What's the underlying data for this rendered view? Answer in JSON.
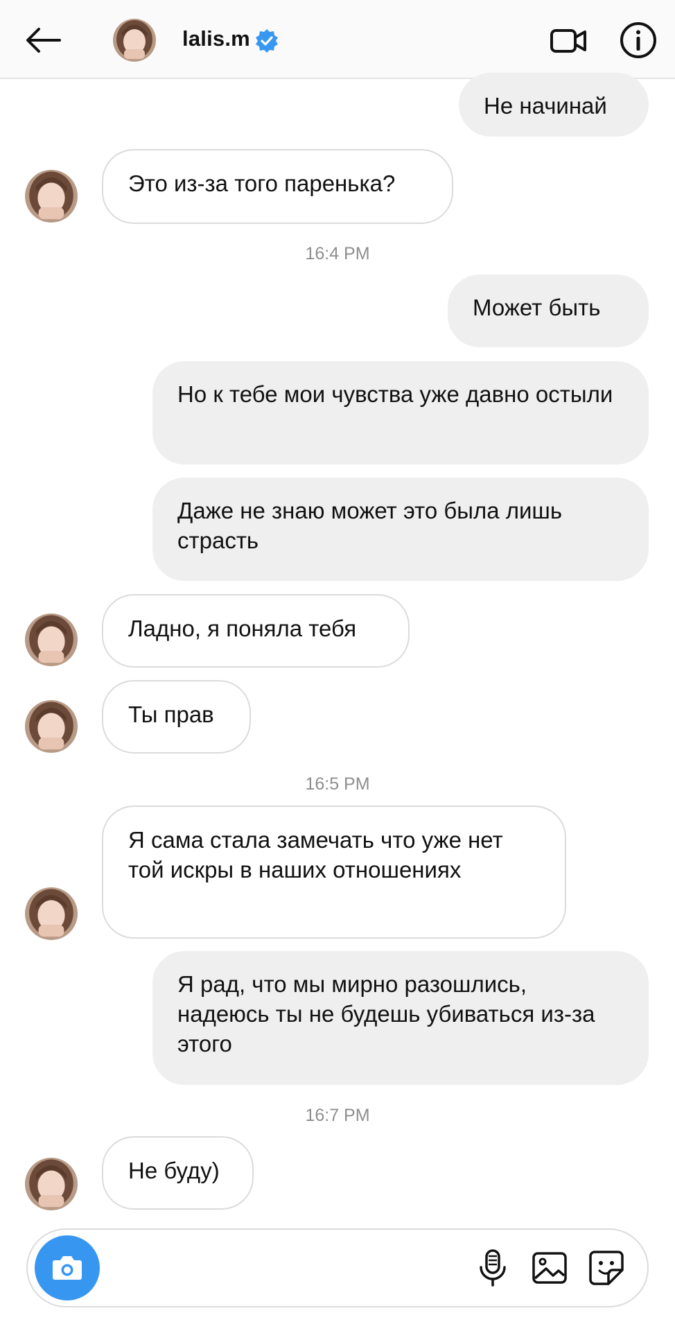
{
  "header": {
    "username": "lalis.m",
    "verified": true,
    "accent": "#3897f0"
  },
  "messages": [
    {
      "side": "out",
      "text": "Не начинай"
    },
    {
      "side": "in",
      "text": "Это из-за того паренька?"
    },
    {
      "type": "timestamp",
      "text": "16:4 PM"
    },
    {
      "side": "out",
      "text": "Может быть"
    },
    {
      "side": "out",
      "text": "Но к тебе мои чувства уже давно остыли"
    },
    {
      "side": "out",
      "text": "Даже не знаю может это была лишь страсть"
    },
    {
      "side": "in",
      "text": "Ладно, я поняла тебя"
    },
    {
      "side": "in",
      "text": "Ты прав"
    },
    {
      "type": "timestamp",
      "text": "16:5 PM"
    },
    {
      "side": "in",
      "text": "Я сама стала замечать что уже нет той искры в наших отношениях"
    },
    {
      "side": "out",
      "text": "Я рад, что мы мирно разошлись, надеюсь ты не будешь убиваться из-за этого"
    },
    {
      "type": "timestamp",
      "text": "16:7 PM"
    },
    {
      "side": "in",
      "text": "Не буду)"
    }
  ],
  "composer": {
    "placeholder": "",
    "icons": [
      "camera-icon",
      "microphone-icon",
      "gallery-icon",
      "sticker-icon"
    ]
  }
}
